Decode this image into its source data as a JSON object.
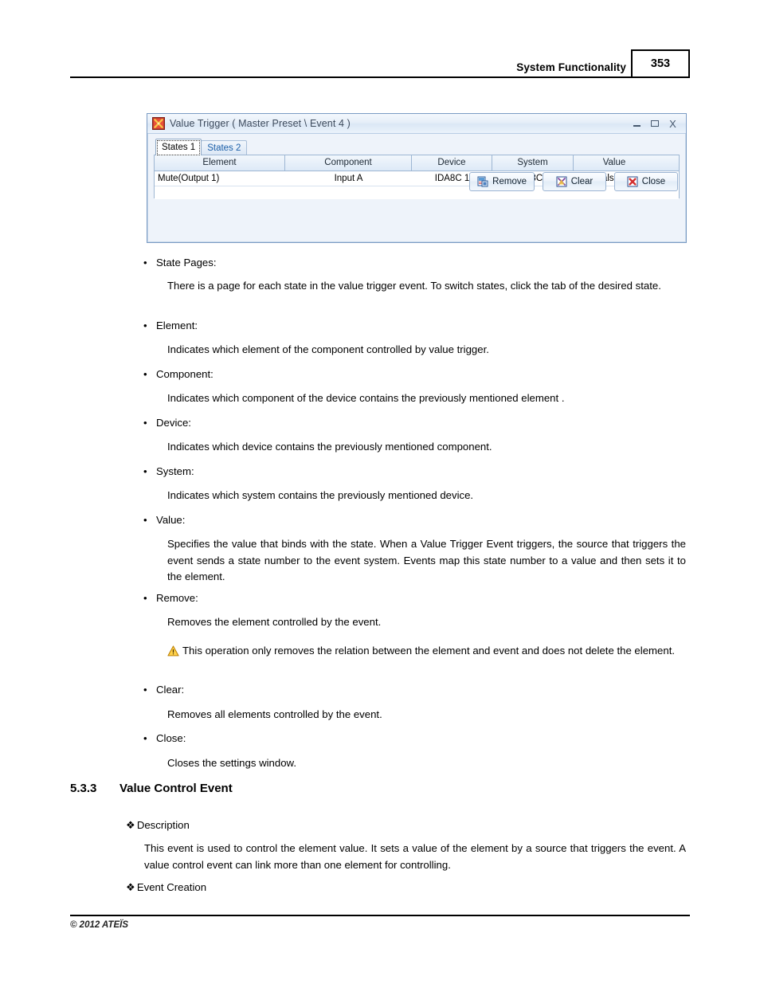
{
  "page_header": {
    "title": "System Functionality",
    "page_number": "353"
  },
  "dialog": {
    "icon": "value-trigger-icon",
    "title": "Value Trigger ( Master Preset \\ Event 4 )",
    "window_controls": {
      "minimize": "–",
      "maximize": "▭",
      "close": "X"
    },
    "tabs": [
      {
        "label": "States 1",
        "active": true
      },
      {
        "label": "States 2",
        "active": false
      }
    ],
    "table": {
      "columns": [
        "Element",
        "Component",
        "Device",
        "System",
        "Value"
      ],
      "rows": [
        {
          "element": "Mute(Output 1)",
          "component": "Input A",
          "device": "IDA8C 1",
          "system": "IDA8C 1",
          "value": "False",
          "value_more": "···"
        }
      ]
    },
    "buttons": [
      {
        "label": "Remove",
        "icon": "remove-icon"
      },
      {
        "label": "Clear",
        "icon": "clear-icon"
      },
      {
        "label": "Close",
        "icon": "close-icon"
      }
    ]
  },
  "body": {
    "bullets": [
      {
        "term": "State Pages:",
        "text": "There is a page for each state in the value trigger event. To switch states, click the tab of the desired state."
      },
      {
        "term": "Element:",
        "text": "Indicates which element of the component controlled by value trigger."
      },
      {
        "term": "Component:",
        "text": "Indicates which component of the device contains the previously mentioned element ."
      },
      {
        "term": "Device:",
        "text": "Indicates which device contains the previously mentioned component."
      },
      {
        "term": "System:",
        "text": "Indicates which system contains the previously mentioned device."
      },
      {
        "term": "Value:",
        "text": "Specifies the value that binds with the state. When a Value Trigger Event triggers, the source that triggers the event sends a state number to the event system. Events map this state number to a value and then sets it to the element."
      },
      {
        "term": "Remove:",
        "text": "Removes the element controlled by the event."
      },
      {
        "term": "Clear:",
        "text": "Removes all elements controlled by the event."
      },
      {
        "term": "Close:",
        "text": "Closes the settings window."
      }
    ],
    "note": "This operation only removes the relation between the element and event and does not delete the element.",
    "section": {
      "number": "5.3.3",
      "title": "Value Control Event"
    },
    "description_label": "Description",
    "description_text": "This event is used to control the element value. It sets a value of the element by a source that triggers the event. A value control event can link more than one element for controlling.",
    "event_creation_label": "Event Creation",
    "diamond_glyph": "❖",
    "bullet_glyph": "•"
  },
  "footer": {
    "copyright": "© 2012 ATEÏS"
  }
}
